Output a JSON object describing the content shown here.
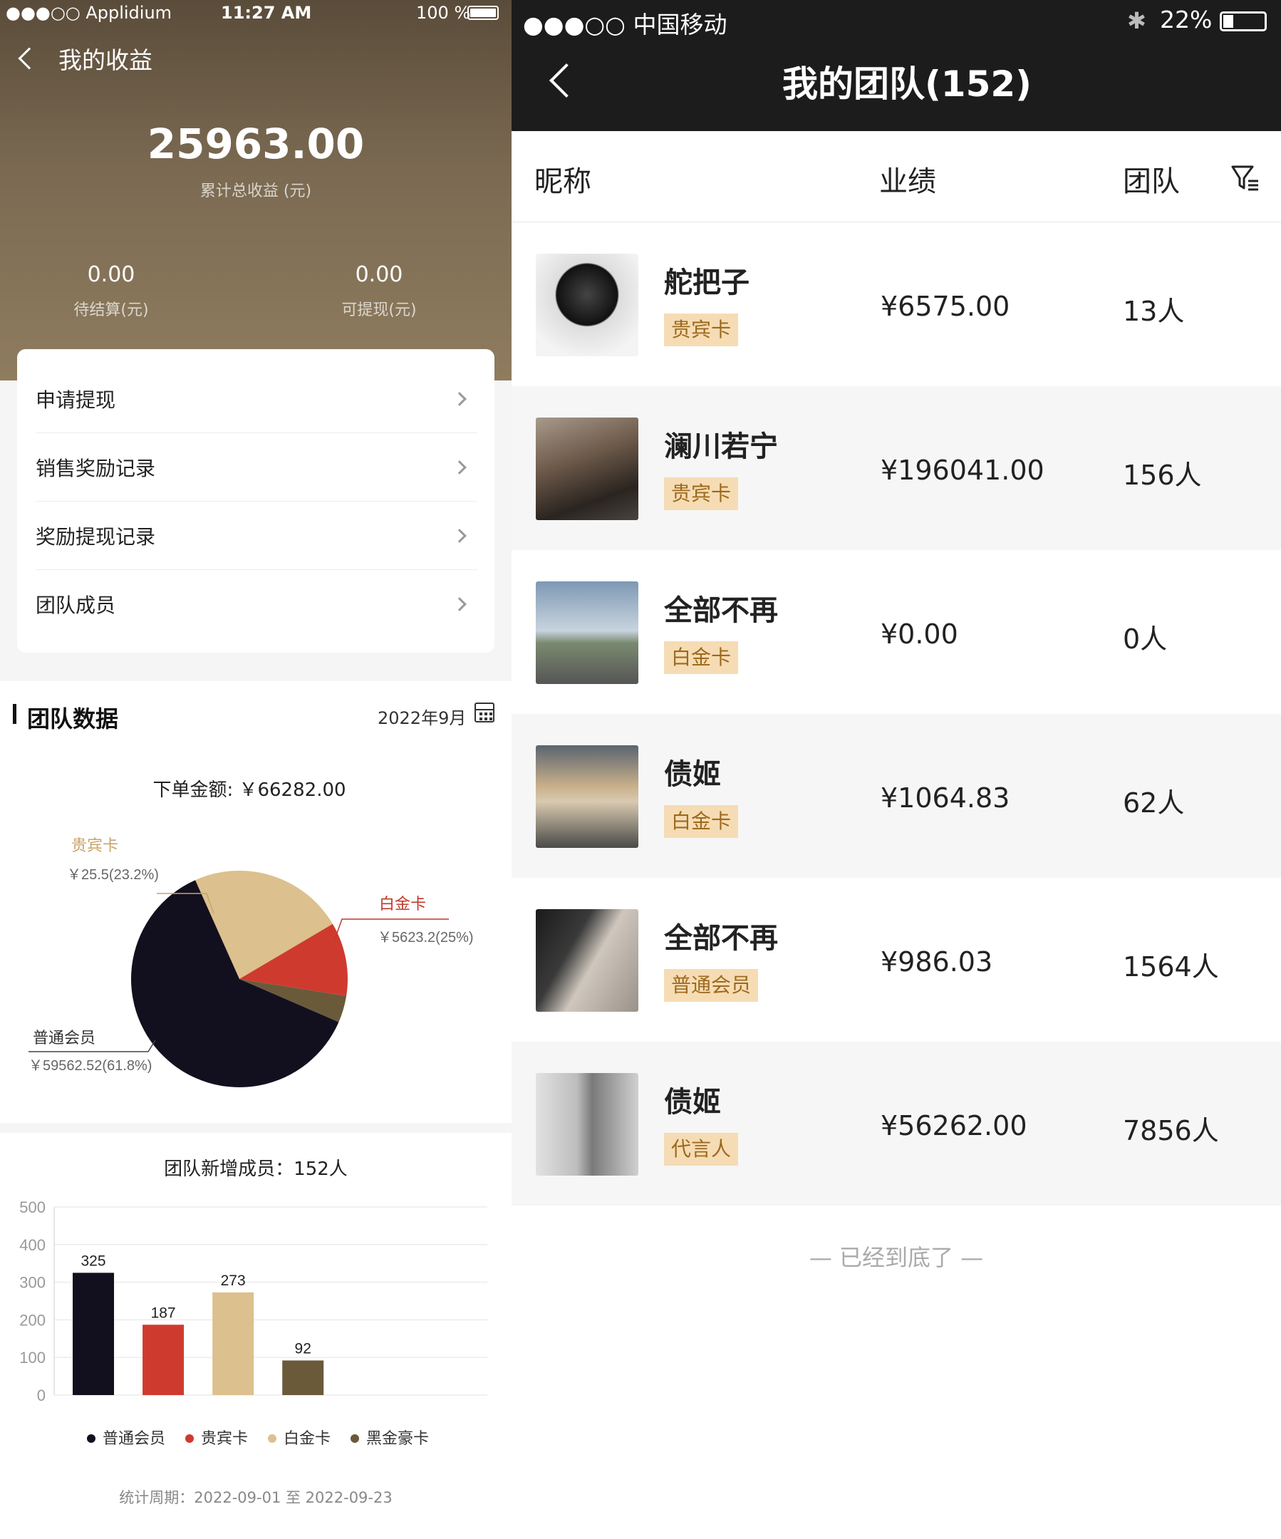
{
  "left": {
    "status": {
      "carrier": "●●●○○ Applidium",
      "time": "11:27 AM",
      "battery": "100 %"
    },
    "nav_title": "我的收益",
    "total_amount": "25963.00",
    "total_label": "累计总收益 (元)",
    "pending_value": "0.00",
    "pending_label": "待结算(元)",
    "withdrawable_value": "0.00",
    "withdrawable_label": "可提现(元)",
    "menu": [
      {
        "label": "申请提现"
      },
      {
        "label": "销售奖励记录"
      },
      {
        "label": "奖励提现记录"
      },
      {
        "label": "团队成员"
      }
    ],
    "team_data": {
      "title": "团队数据",
      "date": "2022年9月",
      "order_amount": "下单金额: ￥66282.00"
    },
    "pie_labels": [
      {
        "name": "贵宾卡",
        "value": "￥25.5(23.2%)",
        "color": "#c8a46a"
      },
      {
        "name": "白金卡",
        "value": "￥5623.2(25%)",
        "color": "#c0392b"
      },
      {
        "name": "普通会员",
        "value": "￥59562.52(61.8%)",
        "color": "#333333"
      }
    ],
    "bar_title": "团队新增成员：152人",
    "period": "统计周期：2022-09-01 至 2022-09-23"
  },
  "chart_data": [
    {
      "type": "pie",
      "title": "下单金额: ￥66282.00",
      "labels": [
        "普通会员",
        "贵宾卡",
        "白金卡",
        "黑金豪卡"
      ],
      "values": [
        61.8,
        23.2,
        11.0,
        4.0
      ],
      "colors": [
        "#12101f",
        "#dcc08e",
        "#cf3a2f",
        "#6a5a3a"
      ]
    },
    {
      "type": "bar",
      "title": "团队新增成员：152人",
      "categories": [
        "普通会员",
        "贵宾卡",
        "白金卡",
        "黑金豪卡"
      ],
      "values": [
        325,
        187,
        273,
        92
      ],
      "colors": [
        "#12101f",
        "#cf3a2f",
        "#dcc08e",
        "#6a5a3a"
      ],
      "ylim": [
        0,
        500
      ],
      "yticks": [
        "500",
        "400",
        "300",
        "200",
        "100",
        "0"
      ],
      "legend": [
        {
          "name": "普通会员",
          "color": "#12101f"
        },
        {
          "name": "贵宾卡",
          "color": "#cf3a2f"
        },
        {
          "name": "白金卡",
          "color": "#dcc08e"
        },
        {
          "name": "黑金豪卡",
          "color": "#6a5a3a"
        }
      ]
    }
  ],
  "right": {
    "status": {
      "carrier": "●●●○○ 中国移动",
      "battery": "22%"
    },
    "title": "我的团队(152)",
    "columns": {
      "name": "昵称",
      "performance": "业绩",
      "team": "团队"
    },
    "rows": [
      {
        "name": "舵把子",
        "badge": "贵宾卡",
        "performance": "¥6575.00",
        "team": "13人"
      },
      {
        "name": "澜川若宁",
        "badge": "贵宾卡",
        "performance": "¥196041.00",
        "team": "156人"
      },
      {
        "name": "全部不再",
        "badge": "白金卡",
        "performance": "¥0.00",
        "team": "0人"
      },
      {
        "name": "债姬",
        "badge": "白金卡",
        "performance": "¥1064.83",
        "team": "62人"
      },
      {
        "name": "全部不再",
        "badge": "普通会员",
        "performance": "¥986.03",
        "team": "1564人"
      },
      {
        "name": "债姬",
        "badge": "代言人",
        "performance": "¥56262.00",
        "team": "7856人"
      }
    ],
    "end_note": "— 已经到底了 —"
  }
}
